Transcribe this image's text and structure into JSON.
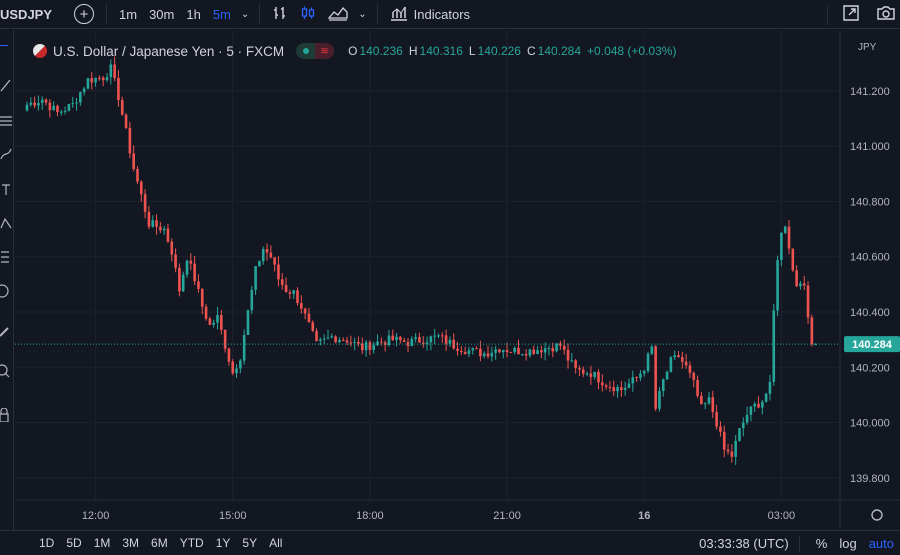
{
  "toolbar": {
    "symbol": "USDJPY",
    "intervals": [
      {
        "label": "1m",
        "active": false
      },
      {
        "label": "30m",
        "active": false
      },
      {
        "label": "1h",
        "active": false
      },
      {
        "label": "5m",
        "active": true
      }
    ],
    "indicators_label": "Indicators",
    "icons": [
      "plus-icon",
      "chevron-down-icon",
      "bar-chart-icon",
      "candles-icon",
      "area-chart-icon",
      "indicators-icon",
      "fullscreen-icon",
      "camera-icon"
    ]
  },
  "legend": {
    "title": "U.S. Dollar / Japanese Yen · 5 · FXCM",
    "market_status_icon": "≋",
    "o_key": "O",
    "o": "140.236",
    "h_key": "H",
    "h": "140.316",
    "l_key": "L",
    "l": "140.226",
    "c_key": "C",
    "c": "140.284",
    "change": "+0.048 (+0.03%)"
  },
  "price_axis": {
    "currency": "JPY",
    "last_price": "140.284",
    "last_price_value": 140.284
  },
  "colors": {
    "up": "#26a69a",
    "down": "#ef5350",
    "grid": "#1e222d",
    "background": "#131722",
    "accent": "#2962ff"
  },
  "chart_data": {
    "type": "candlestick",
    "y_ticks": [
      141.2,
      141.0,
      140.8,
      140.6,
      140.4,
      140.2,
      140.0,
      139.8
    ],
    "y_tick_labels": [
      "141.200",
      "141.000",
      "140.800",
      "140.600",
      "140.400",
      "140.200",
      "140.000",
      "139.800"
    ],
    "ylim": [
      139.72,
      141.42
    ],
    "x_ticks": [
      {
        "label": "12:00",
        "bar": 18
      },
      {
        "label": "15:00",
        "bar": 54
      },
      {
        "label": "18:00",
        "bar": 90
      },
      {
        "label": "21:00",
        "bar": 126
      },
      {
        "label": "16",
        "bar": 162
      },
      {
        "label": "03:00",
        "bar": 198
      }
    ],
    "bar_count": 210,
    "close_path": [
      [
        0,
        141.15
      ],
      [
        4,
        141.17
      ],
      [
        8,
        141.12
      ],
      [
        12,
        141.15
      ],
      [
        16,
        141.24
      ],
      [
        20,
        141.25
      ],
      [
        22,
        141.28
      ],
      [
        24,
        141.18
      ],
      [
        26,
        141.05
      ],
      [
        28,
        140.92
      ],
      [
        30,
        140.82
      ],
      [
        32,
        140.72
      ],
      [
        36,
        140.7
      ],
      [
        38,
        140.62
      ],
      [
        40,
        140.48
      ],
      [
        42,
        140.6
      ],
      [
        44,
        140.52
      ],
      [
        46,
        140.42
      ],
      [
        48,
        140.35
      ],
      [
        50,
        140.38
      ],
      [
        52,
        140.28
      ],
      [
        54,
        140.18
      ],
      [
        56,
        140.24
      ],
      [
        58,
        140.4
      ],
      [
        60,
        140.55
      ],
      [
        62,
        140.63
      ],
      [
        64,
        140.6
      ],
      [
        66,
        140.52
      ],
      [
        68,
        140.48
      ],
      [
        70,
        140.47
      ],
      [
        72,
        140.42
      ],
      [
        74,
        140.35
      ],
      [
        76,
        140.28
      ],
      [
        80,
        140.31
      ],
      [
        84,
        140.3
      ],
      [
        88,
        140.27
      ],
      [
        92,
        140.29
      ],
      [
        96,
        140.3
      ],
      [
        100,
        140.29
      ],
      [
        104,
        140.3
      ],
      [
        108,
        140.31
      ],
      [
        112,
        140.28
      ],
      [
        116,
        140.26
      ],
      [
        120,
        140.25
      ],
      [
        124,
        140.27
      ],
      [
        128,
        140.26
      ],
      [
        132,
        140.26
      ],
      [
        136,
        140.27
      ],
      [
        140,
        140.28
      ],
      [
        142,
        140.23
      ],
      [
        144,
        140.19
      ],
      [
        148,
        140.18
      ],
      [
        152,
        140.14
      ],
      [
        156,
        140.12
      ],
      [
        160,
        140.16
      ],
      [
        162,
        140.2
      ],
      [
        164,
        140.27
      ],
      [
        165,
        140.05
      ],
      [
        167,
        140.15
      ],
      [
        169,
        140.22
      ],
      [
        171,
        140.24
      ],
      [
        173,
        140.2
      ],
      [
        175,
        140.14
      ],
      [
        177,
        140.05
      ],
      [
        179,
        140.08
      ],
      [
        181,
        140.0
      ],
      [
        183,
        139.9
      ],
      [
        185,
        139.88
      ],
      [
        187,
        139.97
      ],
      [
        189,
        140.03
      ],
      [
        191,
        140.06
      ],
      [
        193,
        140.08
      ],
      [
        195,
        140.13
      ],
      [
        196,
        140.4
      ],
      [
        197,
        140.6
      ],
      [
        198,
        140.68
      ],
      [
        199,
        140.72
      ],
      [
        200,
        140.64
      ],
      [
        201,
        140.55
      ],
      [
        202,
        140.5
      ],
      [
        203,
        140.52
      ],
      [
        204,
        140.48
      ],
      [
        205,
        140.38
      ],
      [
        206,
        140.3
      ],
      [
        207,
        140.284
      ]
    ]
  },
  "bottom": {
    "ranges": [
      "1D",
      "5D",
      "1M",
      "3M",
      "6M",
      "YTD",
      "1Y",
      "5Y",
      "All"
    ],
    "clock": "03:33:38 (UTC)",
    "percent": "%",
    "log": "log",
    "auto": "auto"
  }
}
